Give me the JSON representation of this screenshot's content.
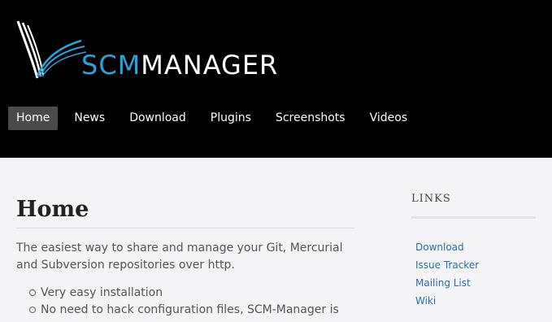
{
  "header": {
    "logo": {
      "text_scm": "SCM",
      "text_manager": "MANAGER"
    },
    "nav": [
      {
        "label": "Home",
        "active": true
      },
      {
        "label": "News",
        "active": false
      },
      {
        "label": "Download",
        "active": false
      },
      {
        "label": "Plugins",
        "active": false
      },
      {
        "label": "Screenshots",
        "active": false
      },
      {
        "label": "Videos",
        "active": false
      }
    ]
  },
  "main": {
    "title": "Home",
    "intro": "The easiest way to share and manage your Git, Mercurial and Subversion repositories over http.",
    "features": [
      "Very easy installation",
      "No need to hack configuration files, SCM-Manager is"
    ]
  },
  "sidebar": {
    "title": "LINKS",
    "links": [
      "Download",
      "Issue Tracker",
      "Mailing List",
      "Wiki"
    ]
  },
  "colors": {
    "header_bg": "#000000",
    "accent_blue": "#2aa3d9",
    "link": "#2a6ea8",
    "nav_active_bg": "#4a4a4a"
  }
}
